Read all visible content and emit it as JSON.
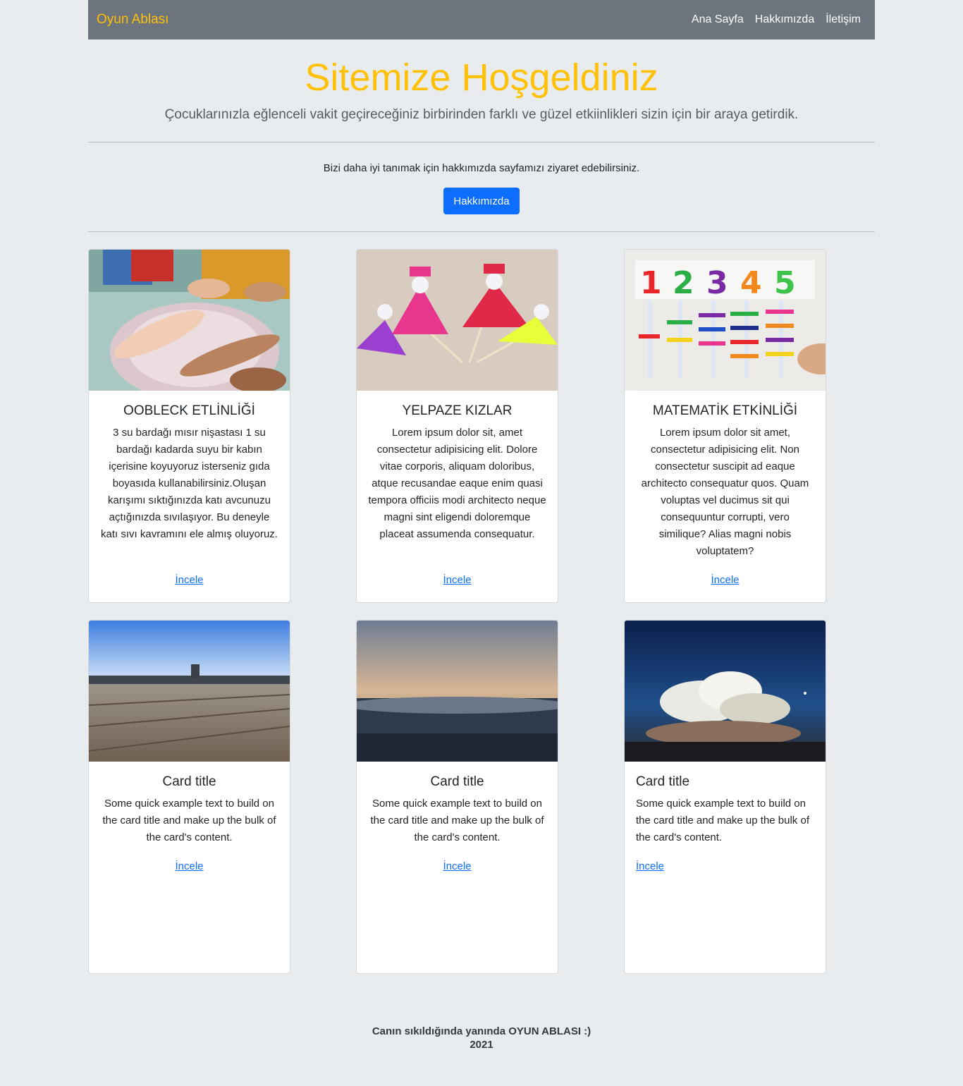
{
  "navbar": {
    "brand": "Oyun Ablası",
    "links": [
      "Ana Sayfa",
      "Hakkımızda",
      "İletişim"
    ]
  },
  "hero": {
    "title": "Sitemize Hoşgeldiniz",
    "lead": "Çocuklarınızla eğlenceli vakit geçireceğiniz birbirinden farklı ve güzel etkiinlikleri sizin için bir araya getirdik."
  },
  "about": {
    "text": "Bizi daha iyi tanımak için hakkımızda sayfamızı ziyaret edebilirsiniz.",
    "button": "Hakkımızda"
  },
  "cards": [
    {
      "title": "OOBLECK ETLİNLİĞİ",
      "text": "3 su bardağı mısır nişastası 1 su bardağı kadarda suyu bir kabın içerisine koyuyoruz isterseniz gıda boyasıda kullanabilirsiniz.Oluşan karışımı sıktığınızda katı avcunuzu açtığınızda sıvılaşıyor. Bu deneyle katı sıvı kavramını ele almış oluyoruz.",
      "link": "İncele",
      "image": "hands-in-bowl"
    },
    {
      "title": "YELPAZE KIZLAR",
      "text": "Lorem ipsum dolor sit, amet consectetur adipisicing elit. Dolore vitae corporis, aliquam doloribus, atque recusandae eaque enim quasi tempora officiis modi architecto neque magni sint eligendi doloremque placeat assumenda consequatur.",
      "link": "İncele",
      "image": "paper-fan-dolls"
    },
    {
      "title": "MATEMATİK ETKİNLİĞİ",
      "text": "Lorem ipsum dolor sit amet, consectetur adipisicing elit. Non consectetur suscipit ad eaque architecto consequatur quos. Quam voluptas vel ducimus sit qui consequuntur corrupti, vero similique? Alias magni nobis voluptatem?",
      "link": "İncele",
      "image": "number-clothespins"
    },
    {
      "title": "Card title",
      "text": "Some quick example text to build on the card title and make up the bulk of the card's content.",
      "link": "İncele",
      "image": "wooden-pier"
    },
    {
      "title": "Card title",
      "text": "Some quick example text to build on the card title and make up the bulk of the card's content.",
      "link": "İncele",
      "image": "sea-sunset"
    },
    {
      "title": "Card title",
      "text": "Some quick example text to build on the card title and make up the bulk of the card's content.",
      "link": "İncele",
      "image": "cloud-sky"
    }
  ],
  "footer": {
    "line1": "Canın sıkıldığında yanında OYUN ABLASI :)",
    "line2": "2021"
  },
  "colors": {
    "accent": "#ffc107",
    "navbar": "#6c757d",
    "button": "#0d6efd",
    "background": "#e9ecef"
  }
}
